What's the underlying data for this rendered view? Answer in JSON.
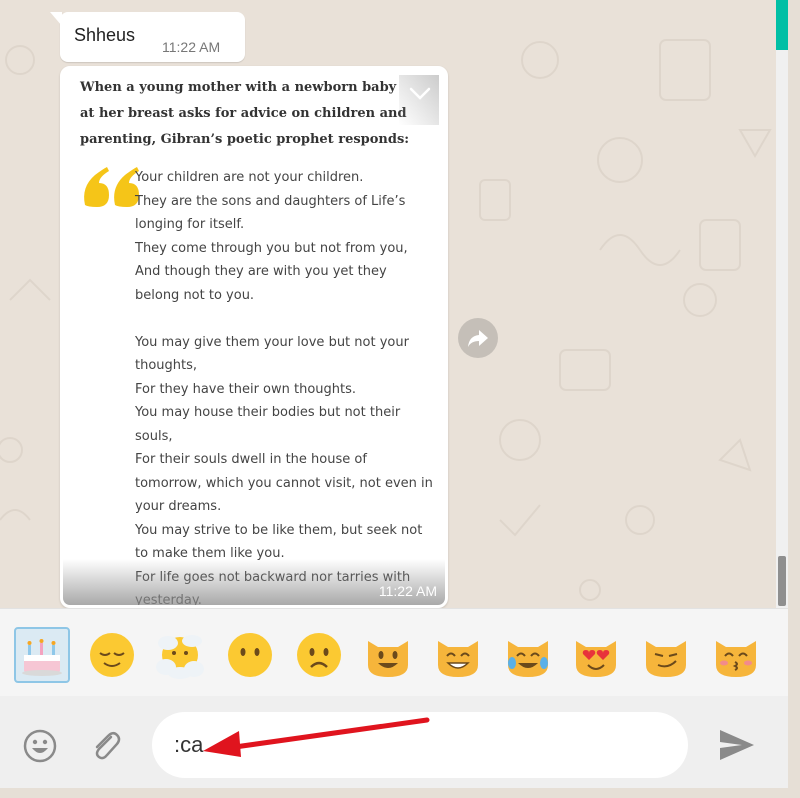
{
  "chat": {
    "sender_name": "Shheus",
    "sender_time": "11:22 AM",
    "image_message": {
      "header": "When a young mother with a newborn baby at her breast asks for advice on children and parenting, Gibran’s poetic prophet responds:",
      "poem": "Your children are not your children.\nThey are the sons and daughters of Life’s longing for itself.\nThey come through you but not from you,\nAnd though they are with you yet they belong not to you.\n\nYou may give them your love but not your thoughts,\nFor they have their own thoughts.\nYou may house their bodies but not their souls,\nFor their souls dwell in the house of tomorrow, which you cannot visit, not even in your dreams.\nYou may strive to be like them, but seek not to make them like you.\nFor life goes not backward nor tarries with yesterday.",
      "time": "11:22 AM"
    }
  },
  "emoji_suggestions": [
    {
      "name": "birthday-cake-emoji",
      "glyph": "🎂",
      "selected": true
    },
    {
      "name": "relieved-face-emoji",
      "glyph": "😌"
    },
    {
      "name": "face-in-clouds-emoji",
      "glyph": "😶‍🌫️"
    },
    {
      "name": "face-without-mouth-emoji",
      "glyph": "😶"
    },
    {
      "name": "frowning-face-emoji",
      "glyph": "☹️"
    },
    {
      "name": "grinning-cat-emoji",
      "glyph": "😺"
    },
    {
      "name": "grinning-cat-smiling-eyes-emoji",
      "glyph": "😸"
    },
    {
      "name": "cat-tears-of-joy-emoji",
      "glyph": "😹"
    },
    {
      "name": "heart-eyes-cat-emoji",
      "glyph": "😻"
    },
    {
      "name": "wry-smile-cat-emoji",
      "glyph": "😼"
    },
    {
      "name": "kissing-cat-emoji",
      "glyph": "😽"
    }
  ],
  "composer": {
    "input_value": ":ca",
    "emoji_icon": "smiley-icon",
    "attach_icon": "paperclip-icon",
    "send_icon": "send-icon"
  },
  "colors": {
    "accent": "#00bfa5",
    "quote_mark": "#f5c518",
    "annotation_arrow": "#e0141e"
  }
}
